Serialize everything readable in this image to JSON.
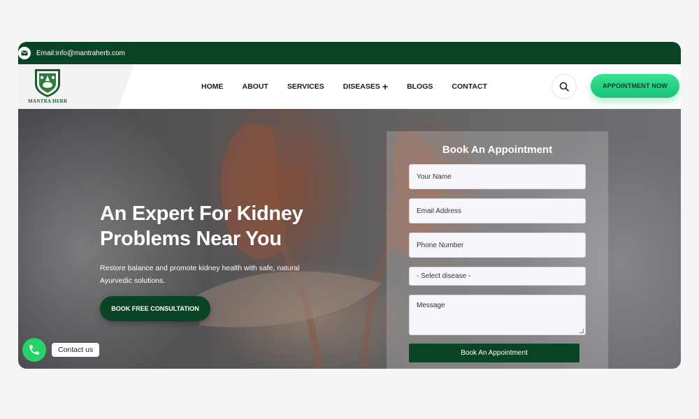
{
  "topbar": {
    "email_text": "Email:info@mantraherb.com"
  },
  "logo": {
    "text": "MANTRA HERB"
  },
  "nav": {
    "items": [
      {
        "label": "HOME"
      },
      {
        "label": "ABOUT"
      },
      {
        "label": "SERVICES"
      },
      {
        "label": "DISEASES"
      },
      {
        "label": "BLOGS"
      },
      {
        "label": "CONTACT"
      }
    ],
    "appointment_label": "APPOINTMENT NOW"
  },
  "hero": {
    "title": "An Expert For Kidney Problems Near You",
    "subtitle": "Restore balance and promote kidney health with safe, natural Ayurvedic solutions.",
    "cta_label": "BOOK FREE CONSULTATION"
  },
  "form": {
    "title": "Book An Appointment",
    "name_placeholder": "Your Name",
    "email_placeholder": "Email Address",
    "phone_placeholder": "Phone Number",
    "disease_selected": "- Select disease -",
    "message_placeholder": "Message",
    "submit_label": "Book An Appointment"
  },
  "contact_widget": {
    "label": "Contact us"
  },
  "colors": {
    "brand_green": "#0b4425",
    "accent_green": "#25d366"
  }
}
